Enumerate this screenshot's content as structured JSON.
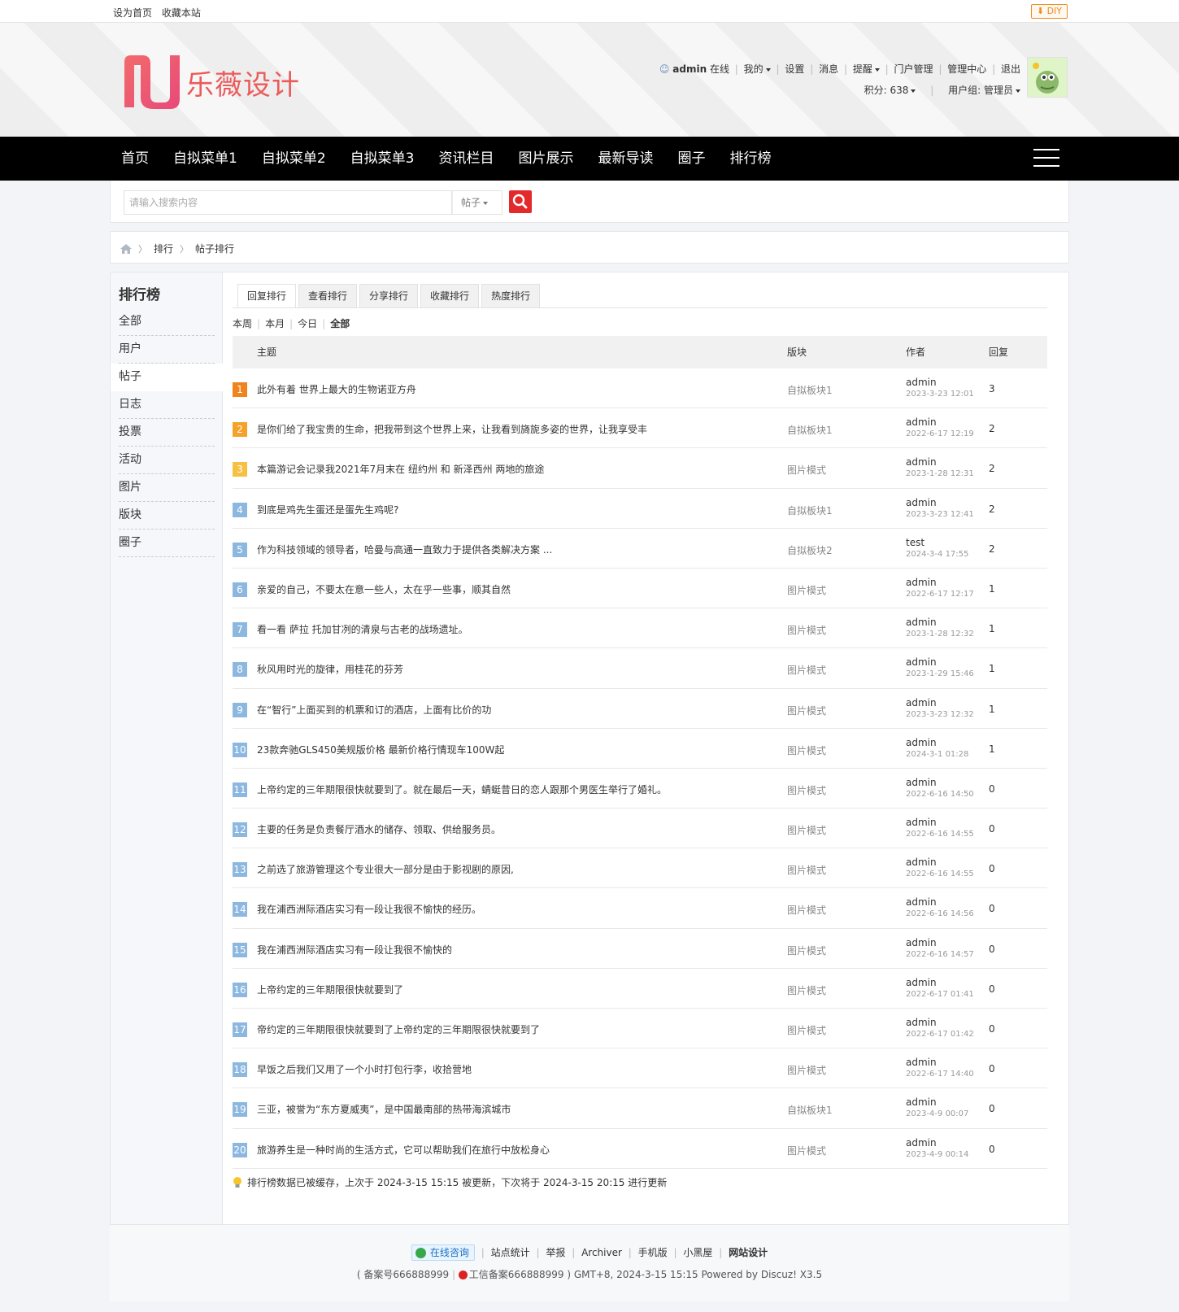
{
  "topbar": {
    "set_home": "设为首页",
    "bookmark": "收藏本站",
    "diy": "DIY"
  },
  "brand": {
    "name": "乐薇设计",
    "accent": "#ec5a5a"
  },
  "user": {
    "name": "admin",
    "status": "在线",
    "links": [
      "我的",
      "设置",
      "消息",
      "提醒",
      "门户管理",
      "管理中心",
      "退出"
    ],
    "points": "积分: 638",
    "group": "用户组: 管理员"
  },
  "nav": {
    "items": [
      "首页",
      "自拟菜单1",
      "自拟菜单2",
      "自拟菜单3",
      "资讯栏目",
      "图片展示",
      "最新导读",
      "圈子",
      "排行榜"
    ]
  },
  "search": {
    "placeholder": "请输入搜索内容",
    "type": "帖子"
  },
  "breadcrumb": {
    "level1": "排行",
    "level2": "帖子排行"
  },
  "sidebar": {
    "title": "排行榜",
    "items": [
      "全部",
      "用户",
      "帖子",
      "日志",
      "投票",
      "活动",
      "图片",
      "版块",
      "圈子"
    ],
    "active_index": 2
  },
  "tabs": [
    "回复排行",
    "查看排行",
    "分享排行",
    "收藏排行",
    "热度排行"
  ],
  "periods": [
    "本周",
    "本月",
    "今日",
    "全部"
  ],
  "columns": {
    "topic": "主题",
    "forum": "版块",
    "author": "作者",
    "replies": "回复"
  },
  "rank_colors": {
    "top1": "#f0831e",
    "top2": "#f6a12a",
    "top3": "#f8c043",
    "rest": "#8cb8e0"
  },
  "rows": [
    {
      "rank": "1",
      "title": "此外有着 世界上最大的生物诺亚方舟",
      "forum": "自拟板块1",
      "author": "admin",
      "date": "2023-3-23 12:01",
      "replies": "3"
    },
    {
      "rank": "2",
      "title": "是你们给了我宝贵的生命，把我带到这个世界上来，让我看到旖旎多姿的世界，让我享受丰",
      "forum": "自拟板块1",
      "author": "admin",
      "date": "2022-6-17 12:19",
      "replies": "2"
    },
    {
      "rank": "3",
      "title": "本篇游记会记录我2021年7月末在 纽约州 和 新泽西州 两地的旅途",
      "forum": "图片模式",
      "author": "admin",
      "date": "2023-1-28 12:31",
      "replies": "2"
    },
    {
      "rank": "4",
      "title": "到底是鸡先生蛋还是蛋先生鸡呢?",
      "forum": "自拟板块1",
      "author": "admin",
      "date": "2023-3-23 12:41",
      "replies": "2"
    },
    {
      "rank": "5",
      "title": "作为科技领域的领导者，哈曼与高通一直致力于提供各类解决方案 ...",
      "forum": "自拟板块2",
      "author": "test",
      "date": "2024-3-4 17:55",
      "replies": "2"
    },
    {
      "rank": "6",
      "title": "亲爱的自己，不要太在意一些人，太在乎一些事，顺其自然",
      "forum": "图片模式",
      "author": "admin",
      "date": "2022-6-17 12:17",
      "replies": "1"
    },
    {
      "rank": "7",
      "title": "看一看 萨拉 托加甘冽的清泉与古老的战场遗址。",
      "forum": "图片模式",
      "author": "admin",
      "date": "2023-1-28 12:32",
      "replies": "1"
    },
    {
      "rank": "8",
      "title": "秋风用时光的旋律，用桂花的芬芳",
      "forum": "图片模式",
      "author": "admin",
      "date": "2023-1-29 15:46",
      "replies": "1"
    },
    {
      "rank": "9",
      "title": "在“智行”上面买到的机票和订的酒店，上面有比价的功",
      "forum": "图片模式",
      "author": "admin",
      "date": "2023-3-23 12:32",
      "replies": "1"
    },
    {
      "rank": "10",
      "title": "23款奔驰GLS450美规版价格 最新价格行情现车100W起",
      "forum": "图片模式",
      "author": "admin",
      "date": "2024-3-1 01:28",
      "replies": "1"
    },
    {
      "rank": "11",
      "title": "上帝约定的三年期限很快就要到了。就在最后一天，蜻蜓昔日的恋人跟那个男医生举行了婚礼。",
      "forum": "图片模式",
      "author": "admin",
      "date": "2022-6-16 14:50",
      "replies": "0"
    },
    {
      "rank": "12",
      "title": "主要的任务是负责餐厅酒水的储存、领取、供给服务员。",
      "forum": "图片模式",
      "author": "admin",
      "date": "2022-6-16 14:55",
      "replies": "0"
    },
    {
      "rank": "13",
      "title": "之前选了旅游管理这个专业很大一部分是由于影视剧的原因,",
      "forum": "图片模式",
      "author": "admin",
      "date": "2022-6-16 14:55",
      "replies": "0"
    },
    {
      "rank": "14",
      "title": "我在浦西洲际酒店实习有一段让我很不愉快的经历。",
      "forum": "图片模式",
      "author": "admin",
      "date": "2022-6-16 14:56",
      "replies": "0"
    },
    {
      "rank": "15",
      "title": "我在浦西洲际酒店实习有一段让我很不愉快的",
      "forum": "图片模式",
      "author": "admin",
      "date": "2022-6-16 14:57",
      "replies": "0"
    },
    {
      "rank": "16",
      "title": "上帝约定的三年期限很快就要到了",
      "forum": "图片模式",
      "author": "admin",
      "date": "2022-6-17 01:41",
      "replies": "0"
    },
    {
      "rank": "17",
      "title": "帝约定的三年期限很快就要到了上帝约定的三年期限很快就要到了",
      "forum": "图片模式",
      "author": "admin",
      "date": "2022-6-17 01:42",
      "replies": "0"
    },
    {
      "rank": "18",
      "title": "早饭之后我们又用了一个小时打包行李，收拾营地",
      "forum": "图片模式",
      "author": "admin",
      "date": "2022-6-17 14:40",
      "replies": "0"
    },
    {
      "rank": "19",
      "title": "三亚，被誉为“东方夏威夷”，是中国最南部的热带海滨城市",
      "forum": "自拟板块1",
      "author": "admin",
      "date": "2023-4-9 00:07",
      "replies": "0"
    },
    {
      "rank": "20",
      "title": "旅游养生是一种时尚的生活方式，它可以帮助我们在旅行中放松身心",
      "forum": "图片模式",
      "author": "admin",
      "date": "2023-4-9 00:14",
      "replies": "0"
    }
  ],
  "notice": "排行榜数据已被缓存，上次于 2024-3-15 15:15 被更新，下次将于 2024-3-15 20:15 进行更新",
  "footer": {
    "consult": "在线咨询",
    "links": [
      "站点统计",
      "举报",
      "Archiver",
      "手机版",
      "小黑屋"
    ],
    "bold_link": "网站设计",
    "icp": "备案号666888999",
    "gongxin": "工信备案666888999",
    "line2_tail": ") GMT+8, 2024-3-15 15:15 Powered by ",
    "powered_name": "Discuz!",
    "version": " X3.5"
  }
}
